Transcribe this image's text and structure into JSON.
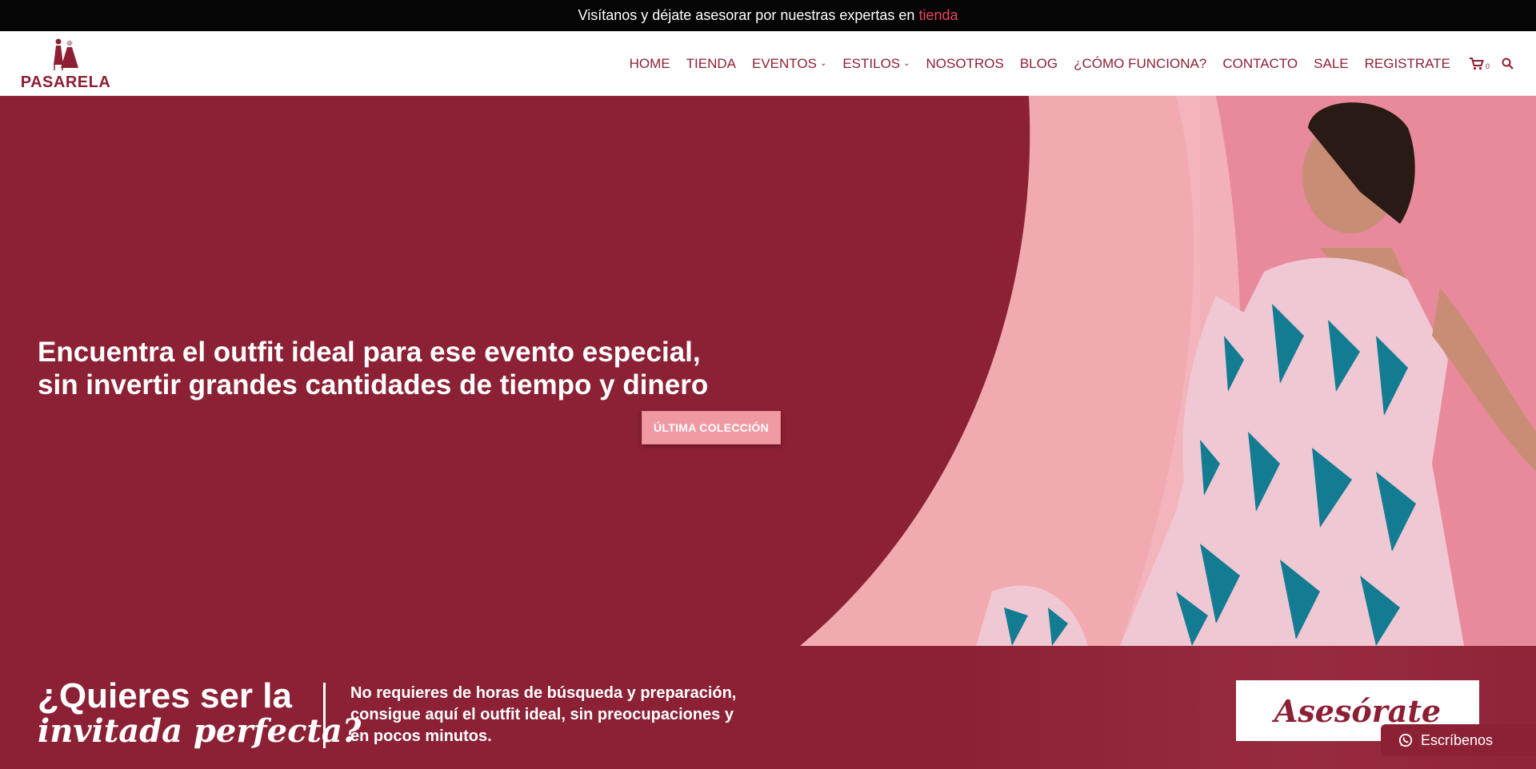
{
  "announcement": {
    "text": "Visítanos y déjate asesorar por nuestras expertas en",
    "link_label": "tienda"
  },
  "header": {
    "logo_text": "PASARELA",
    "nav": [
      {
        "label": "HOME",
        "has_dropdown": false
      },
      {
        "label": "TIENDA",
        "has_dropdown": false
      },
      {
        "label": "EVENTOS",
        "has_dropdown": true
      },
      {
        "label": "ESTILOS",
        "has_dropdown": true
      },
      {
        "label": "NOSOTROS",
        "has_dropdown": false
      },
      {
        "label": "BLOG",
        "has_dropdown": false
      },
      {
        "label": "¿CÓMO FUNCIONA?",
        "has_dropdown": false
      },
      {
        "label": "CONTACTO",
        "has_dropdown": false
      },
      {
        "label": "SALE",
        "has_dropdown": false
      },
      {
        "label": "REGISTRATE",
        "has_dropdown": false
      }
    ],
    "cart_count": "0",
    "icons": {
      "cart": "cart-icon",
      "search": "search-icon",
      "dropdown": "chevron-down-icon"
    }
  },
  "hero": {
    "title_line1": "Encuentra el outfit ideal para ese evento especial,",
    "title_line2": "sin invertir grandes cantidades de tiempo y dinero",
    "cta_label": "ÚLTIMA COLECCIÓN",
    "image": "model-in-floral-dress-photo"
  },
  "band": {
    "heading_line1": "¿Quieres ser la",
    "heading_line2": "invitada perfecta?",
    "text_line1": "No requieres de horas de búsqueda y preparación,",
    "text_line2": "consigue aquí el outfit ideal, sin preocupaciones y",
    "text_line3": "en pocos minutos.",
    "button_label": "Asesórate"
  },
  "whatsapp": {
    "label": "Escríbenos",
    "icon": "whatsapp-icon"
  },
  "colors": {
    "brand": "#8d1f35",
    "hero_left": "#8c2135",
    "hero_pink": "#f1aab0",
    "accent_link": "#e8455f",
    "cta": "#ef9aa3"
  }
}
